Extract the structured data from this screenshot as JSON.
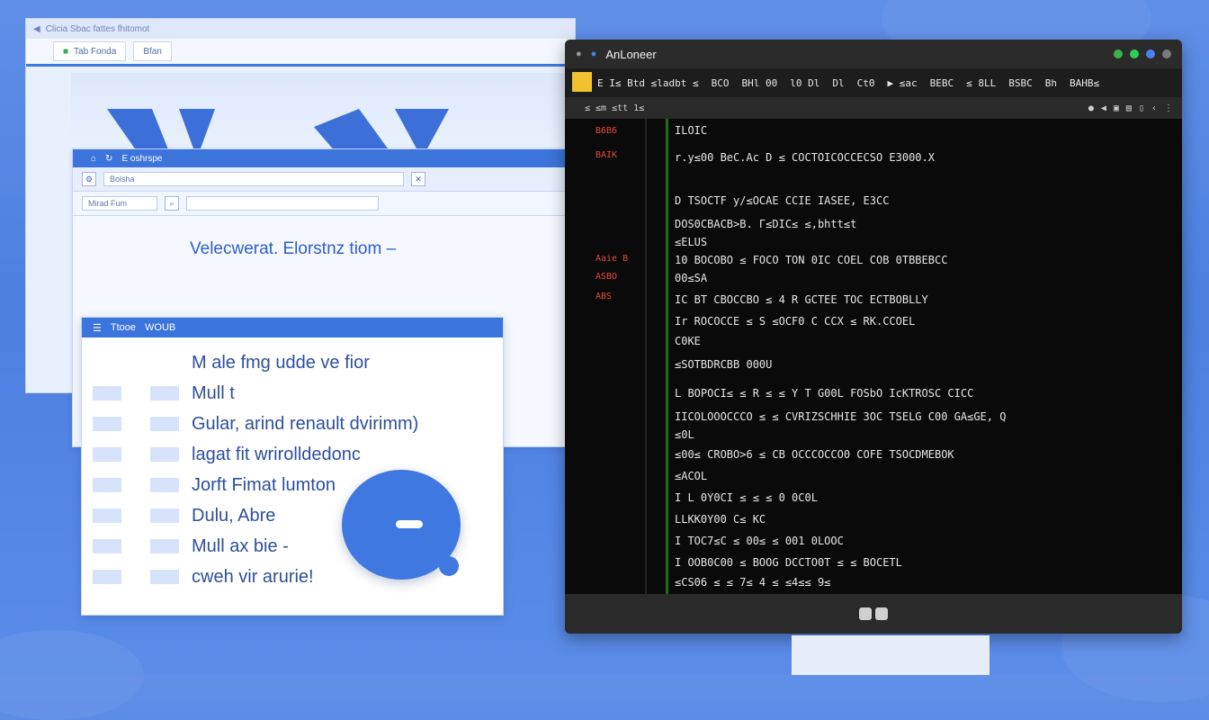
{
  "browser": {
    "window_title": "Clicia Sbac fattes fhitomot",
    "tab_label": "Tab Fonda",
    "tab2_label": "Bfan",
    "nav_bar_text": "E oshrspe",
    "address_text": "Bolsha",
    "filter_label": "Mirad Fum",
    "heading": "Velecwerat. Elorstnz tiom –",
    "section_bar_label": "Ttooe",
    "section_bar_label2": "WOUB"
  },
  "list_items": [
    "M ale fmg udde ve fior",
    "Mull t",
    "Gular, arind renault dvirimm)",
    "lagat fit wrirolldedonc",
    "Jorft Fimat lumton",
    "Dulu, Abre",
    "Mull ax bie -",
    "cweh vir arurie!"
  ],
  "terminal": {
    "title": "AnLoneer",
    "menu": [
      "E I≤ Btd ≤ladbt ≤",
      "BCO",
      "BHl 00",
      "l0 Dl",
      "Dl",
      "Ct0",
      "▶ ≤ac",
      "BEBC",
      "≤ 8LL",
      "BSBC",
      "Bh",
      "BAHB≤"
    ],
    "toolbar_text": "≤ ≤m ≤tt 1≤",
    "side_labels": [
      "B6B6",
      "BAIK",
      "Aaie B",
      "ASBO",
      "ABS"
    ],
    "code_lines": [
      "ILOIC",
      "r.y≤00 BeC.Ac D ≤ COCTOICOCCECSO E3000.X",
      "",
      "D TSOCTF y/≤OCAE CCIE IASEE,  E3CC",
      "DOS0CBACB>B.  Γ≤DIC≤ ≤,bhtt≤t",
      "≤ELUS",
      "10 BOCOBO ≤ FOCO TON 0IC COEL COB 0TBBEBCC",
      "00≤SA",
      "IC BT CBOCCBO ≤ 4 R  GCTEE TOC ECTBOBLLY",
      "Ir ROCOCCE ≤ S ≤OCF0 C CCX ≤ RK.CCOEL",
      "C0KE",
      "≤SOTBDRCBB 000U",
      "L BOPOCI≤ ≤ R ≤ ≤ Y T  G00L FOSbO  IcKTROSC CICC",
      "IICOLOOOCCCO ≤ ≤ CVRIZSCHHIE 3OC TSELG C00 GA≤GE, Q",
      "≤0L",
      "≤00≤ CROBO>6 ≤ CB OCCCOCCO0 COFE TSOCDMEBOK",
      "≤ACOL",
      "I L 0Y0CI ≤ ≤ ≤ 0 0C0L",
      "LLKK0Y00 C≤ KC",
      "I TOC7≤C ≤ 00≤ ≤ 001 0LOOC",
      "I OOB0C00 ≤ BOOG  DCCTO0T ≤ ≤ BOCETL",
      "≤CS06 ≤ ≤ 7≤ 4 ≤ ≤4≤≤ 9≤"
    ]
  },
  "colors": {
    "background": "#4c7fe0",
    "accent": "#3c74dc",
    "terminal_bg": "#0a0a0a",
    "code_green": "#5fd45f",
    "code_red": "#ef4b3b",
    "dot_green": "#38b449",
    "dot_green2": "#2fcf55",
    "dot_blue": "#4b82f2",
    "dot_gray": "#7a7a7a"
  }
}
